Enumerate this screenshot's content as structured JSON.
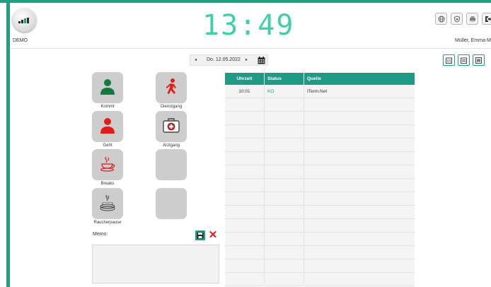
{
  "header": {
    "company": "DEMO",
    "clock": "13:49",
    "user": "Müller, Emma-M"
  },
  "date_nav": {
    "prev": "◂",
    "date": "Do. 12.05.2022",
    "next": "▸"
  },
  "bookings": [
    {
      "label": "Kommt",
      "icon": "person-green-icon"
    },
    {
      "label": "Dienstgang",
      "icon": "walking-person-icon"
    },
    {
      "label": "Geht",
      "icon": "person-red-icon"
    },
    {
      "label": "Arztgang",
      "icon": "first-aid-kit-icon"
    },
    {
      "label": "Breaks",
      "icon": "coffee-cup-icon"
    },
    {
      "label": "",
      "icon": "empty-tile"
    },
    {
      "label": "Raucherpause",
      "icon": "ashtray-icon"
    },
    {
      "label": "",
      "icon": "empty-tile"
    }
  ],
  "memo": {
    "label": "Memo:",
    "cancel": "✕",
    "value": ""
  },
  "table": {
    "columns": [
      "Uhrzeit",
      "Status",
      "Quelle"
    ],
    "rows": [
      [
        "10:01",
        "KO",
        "ITerm.Net"
      ],
      [
        "",
        "",
        ""
      ],
      [
        "",
        "",
        ""
      ],
      [
        "",
        "",
        ""
      ],
      [
        "",
        "",
        ""
      ],
      [
        "",
        "",
        ""
      ],
      [
        "",
        "",
        ""
      ],
      [
        "",
        "",
        ""
      ],
      [
        "",
        "",
        ""
      ],
      [
        "",
        "",
        ""
      ],
      [
        "",
        "",
        ""
      ],
      [
        "",
        "",
        ""
      ],
      [
        "",
        "",
        ""
      ],
      [
        "",
        "",
        ""
      ],
      [
        "",
        "",
        ""
      ]
    ]
  },
  "colors": {
    "accent": "#1fa085",
    "clock": "#3fd0aa",
    "danger": "#e21b1b",
    "status_ok": "#2a9c3b"
  }
}
